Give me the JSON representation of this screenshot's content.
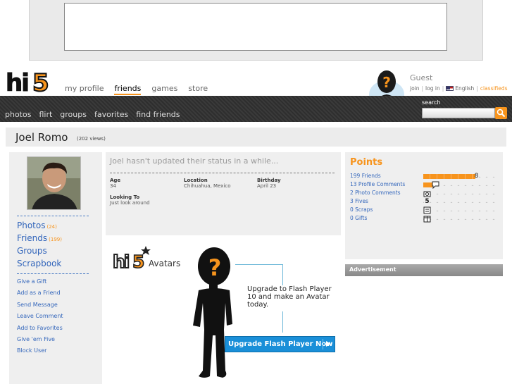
{
  "brand": {
    "logo_text": "hi5",
    "accent": "#f7941d",
    "link": "#3366bb"
  },
  "main_nav": [
    {
      "label": "my profile",
      "active": false
    },
    {
      "label": "friends",
      "active": true
    },
    {
      "label": "games",
      "active": false
    },
    {
      "label": "store",
      "active": false
    }
  ],
  "guest": {
    "name": "Guest",
    "join": "join",
    "login": "log in",
    "language": "English",
    "classifieds": "classifieds",
    "avatar_icon": "question-mark-avatar"
  },
  "sub_nav": [
    "photos",
    "flirt",
    "groups",
    "favorites",
    "find friends"
  ],
  "search": {
    "label": "search",
    "placeholder": "",
    "icon": "magnifier-icon"
  },
  "profile": {
    "name": "Joel Romo",
    "views": "(202 views)",
    "status": "Joel hasn't updated their status in a while...",
    "age_label": "Age",
    "age": "34",
    "location_label": "Location",
    "location": "Chihuahua, Mexico",
    "birthday_label": "Birthday",
    "birthday": "April 23",
    "looking_label": "Looking To",
    "looking": "Just look around"
  },
  "left_links": [
    {
      "label": "Photos",
      "count": "(24)"
    },
    {
      "label": "Friends",
      "count": "(199)"
    },
    {
      "label": "Groups",
      "count": ""
    },
    {
      "label": "Scrapbook",
      "count": ""
    }
  ],
  "actions": [
    "Give a Gift",
    "Add as a Friend",
    "Send Message",
    "Leave Comment",
    "Add to Favorites",
    "Give 'em Five",
    "Block User"
  ],
  "avatars": {
    "logo_text": "hi5",
    "title": "Avatars",
    "upgrade_text": "Upgrade to Flash Player 10 and make an Avatar today.",
    "button": "Upgrade Flash Player Now"
  },
  "points": {
    "title": "Points",
    "rows": [
      {
        "label": "199 Friends",
        "fill_percent": 70,
        "icon": "8"
      },
      {
        "label": "13 Profile Comments",
        "fill_percent": 12,
        "icon": "speech-bubble"
      },
      {
        "label": "2 Photo Comments",
        "fill_percent": 0,
        "icon": "camera"
      },
      {
        "label": "3 Fives",
        "fill_percent": 0,
        "icon": "5"
      },
      {
        "label": "0 Scraps",
        "fill_percent": 0,
        "icon": "scrap"
      },
      {
        "label": "0 Gifts",
        "fill_percent": 0,
        "icon": "gift"
      }
    ]
  },
  "advertisement_label": "Advertisement"
}
